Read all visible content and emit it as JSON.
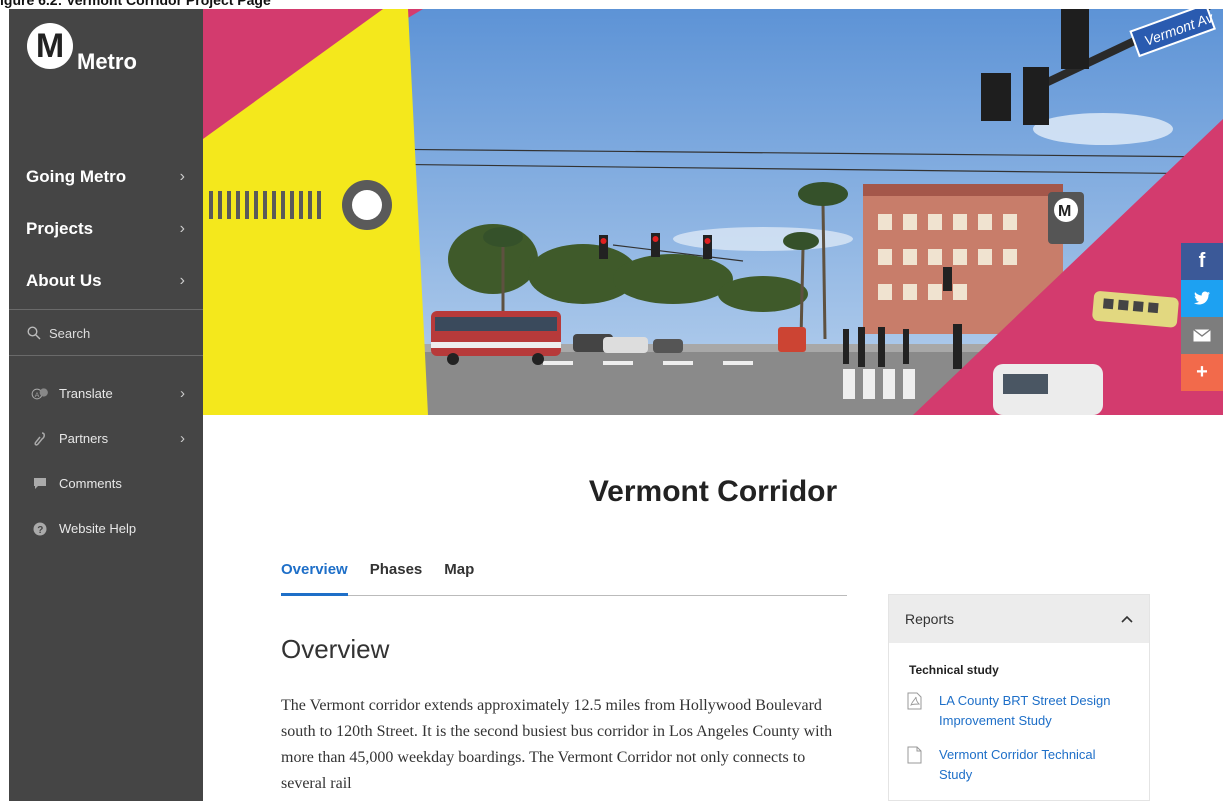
{
  "top_banner": "igure 6.2: Vermont Corridor Project Page",
  "sidebar": {
    "logo_letter": "M",
    "logo_text": "Metro",
    "main_nav": [
      {
        "label": "Going Metro"
      },
      {
        "label": "Projects"
      },
      {
        "label": "About Us"
      }
    ],
    "search_label": "Search",
    "sub_nav": [
      {
        "label": "Translate",
        "icon": "translate-icon"
      },
      {
        "label": "Partners",
        "icon": "link-icon"
      },
      {
        "label": "Comments",
        "icon": "comment-icon"
      },
      {
        "label": "Website Help",
        "icon": "help-icon"
      }
    ]
  },
  "share": [
    {
      "icon": "facebook-icon",
      "glyph": "f",
      "color": "#3b5998"
    },
    {
      "icon": "twitter-icon",
      "glyph": "t",
      "color": "#1da1f2"
    },
    {
      "icon": "email-icon",
      "glyph": "✉",
      "color": "#7d7d7d"
    },
    {
      "icon": "plus-icon",
      "glyph": "+",
      "color": "#f26a4b"
    }
  ],
  "page": {
    "title": "Vermont Corridor",
    "tabs": [
      "Overview",
      "Phases",
      "Map"
    ],
    "active_tab": "Overview",
    "section_heading": "Overview",
    "body": "The Vermont corridor extends approximately 12.5 miles from Hollywood Boulevard south to 120th Street. It is the second busiest bus corridor in Los Angeles County with more than 45,000 weekday boardings. The Vermont Corridor not only connects to several rail"
  },
  "reports": {
    "title": "Reports",
    "subheading": "Technical study",
    "items": [
      {
        "label": "LA County BRT Street Design Improvement Study",
        "icon": "pdf-icon"
      },
      {
        "label": "Vermont Corridor Technical Study",
        "icon": "document-icon"
      }
    ]
  },
  "hero": {
    "street_sign": "Vermont Av",
    "station_letter": "M"
  },
  "colors": {
    "sidebar": "#454545",
    "accent_blue": "#1e6fc8",
    "hero_pink": "#d33b6e",
    "hero_yellow": "#f4e81c"
  }
}
